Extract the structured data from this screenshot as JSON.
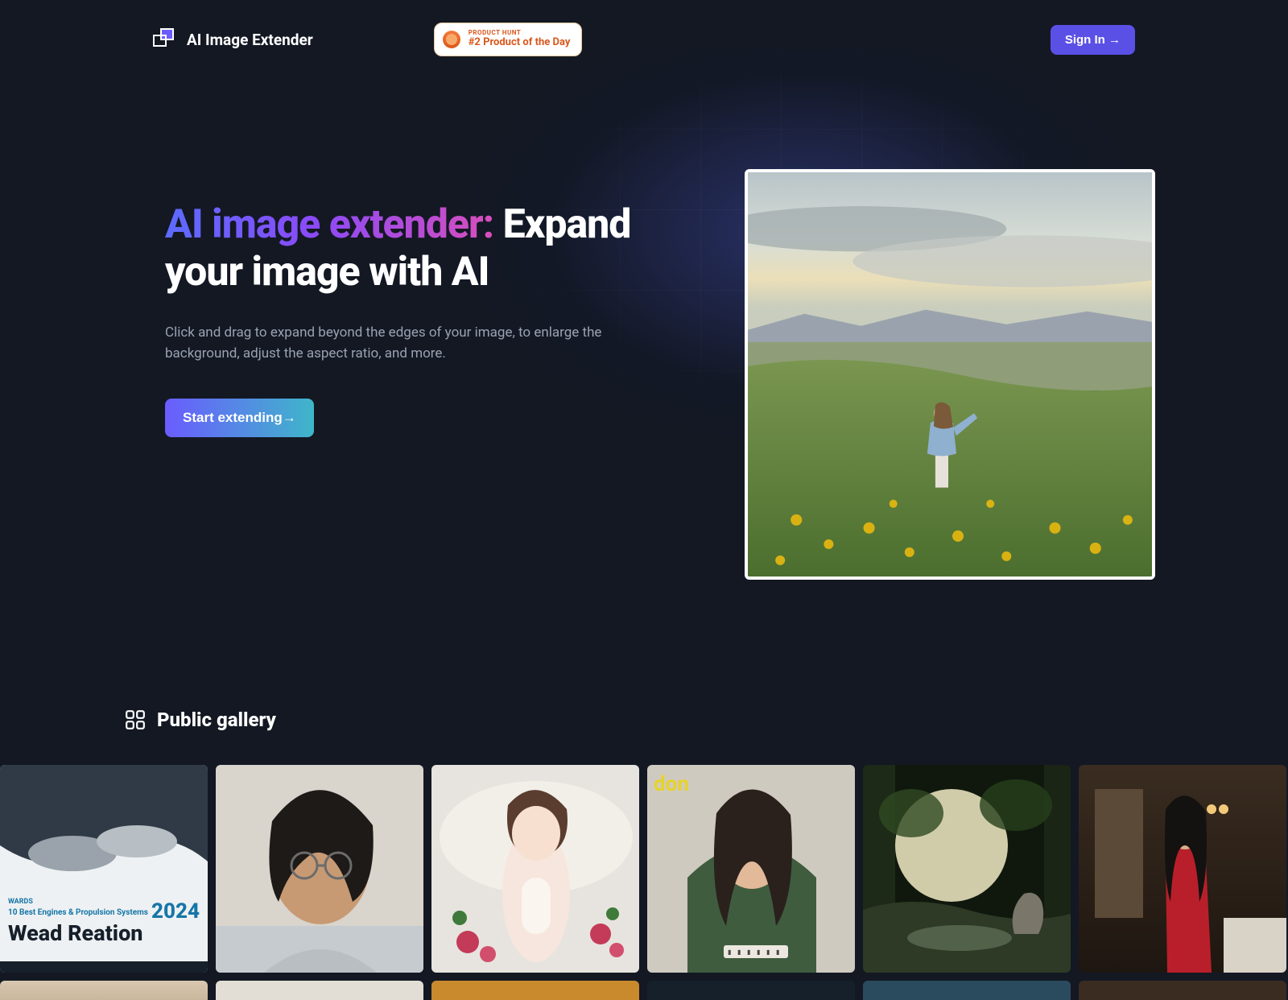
{
  "header": {
    "app_name": "AI Image Extender",
    "product_hunt": {
      "line1": "PRODUCT HUNT",
      "line2": "#2 Product of the Day"
    },
    "signin_label": "Sign In →"
  },
  "hero": {
    "headline_gradient": "AI image extender:",
    "headline_rest": " Expand your image with AI",
    "subtitle": "Click and drag to expand beyond the edges of your image, to enlarge the background, adjust the aspect ratio, and more.",
    "cta_label": "Start extending→",
    "image_alt": "person walking on green hillside with yellow flowers, mountains in distance"
  },
  "gallery": {
    "title": "Public gallery",
    "items": [
      {
        "alt": "Wards 10 Best Engines & Propulsion Systems 2024 poster",
        "caption_top": "WARDS",
        "caption_mid": "10 Best Engines & Propulsion Systems",
        "year": "2024",
        "big": "Wead Reation"
      },
      {
        "alt": "young man with glasses selfie"
      },
      {
        "alt": "anime girl lying on bed with flowers"
      },
      {
        "alt": "woman in green top selfie",
        "overlay": "don"
      },
      {
        "alt": "forest stream with elephant, sunlight through trees"
      },
      {
        "alt": "woman in red dress standing in bedroom"
      }
    ]
  }
}
